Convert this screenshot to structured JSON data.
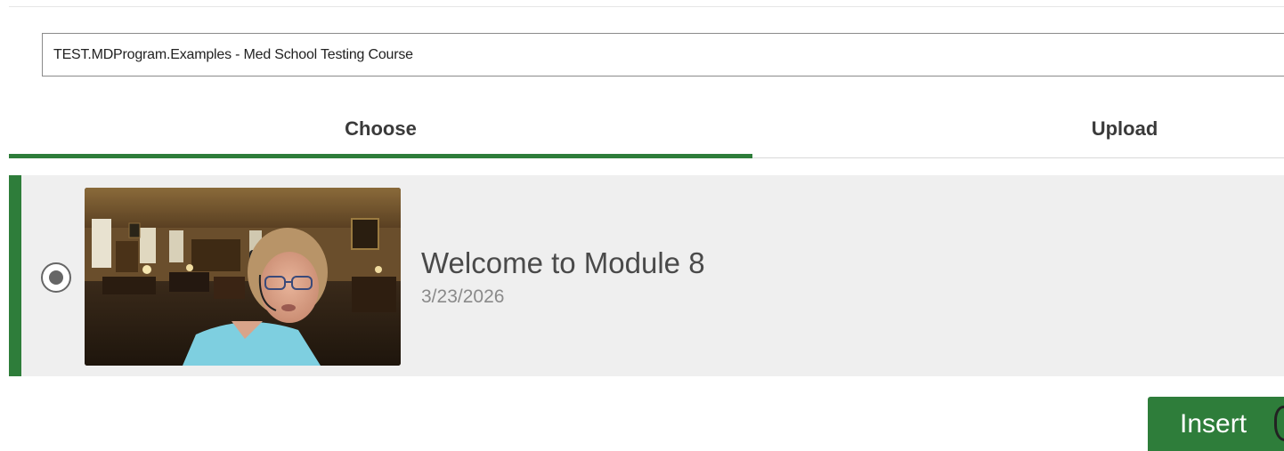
{
  "course_selector": {
    "value": "TEST.MDProgram.Examples - Med School Testing Course"
  },
  "tabs": [
    {
      "label": "Choose",
      "selected": true
    },
    {
      "label": "Upload",
      "selected": false
    }
  ],
  "media_items": [
    {
      "title": "Welcome to Module 8",
      "date": "3/23/2026",
      "selected": true,
      "thumbnail": "webcam-video-thumbnail"
    }
  ],
  "actions": {
    "insert_label": "Insert",
    "insert_icon": "feedback-bubble-icon"
  },
  "colors": {
    "accent": "#2e7d3a",
    "row_background": "#efefef",
    "text_primary": "#4a4a4a",
    "text_secondary": "#8a8a8a"
  }
}
